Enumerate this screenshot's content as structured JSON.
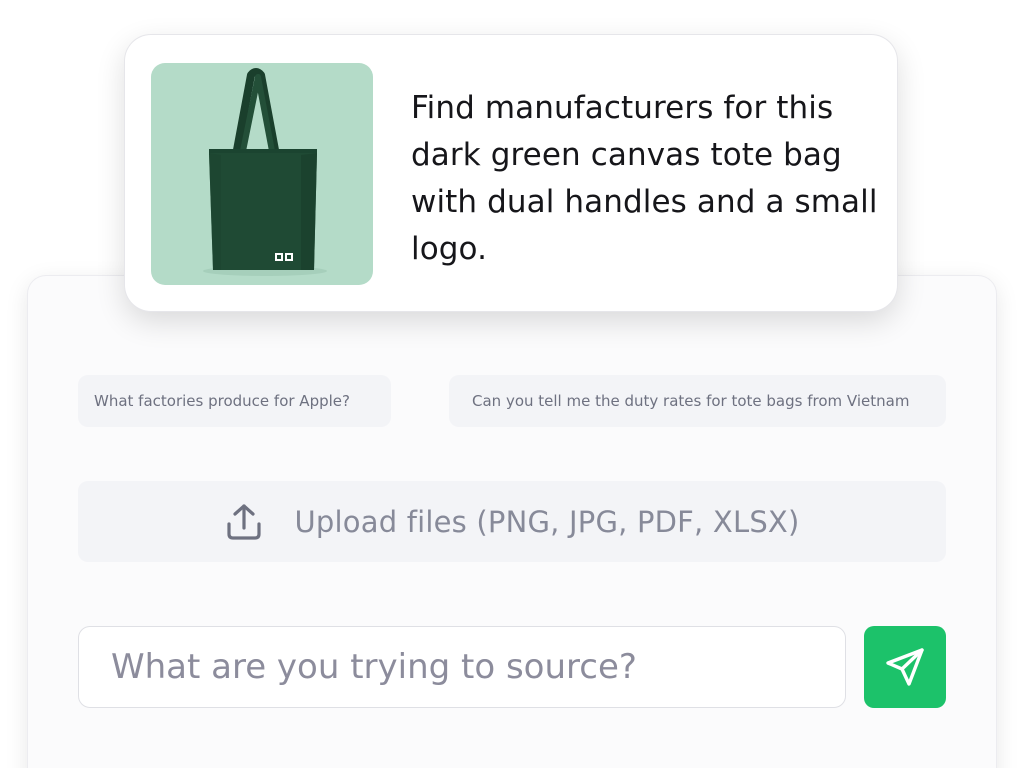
{
  "message": {
    "text": "Find manufacturers for this dark green canvas tote bag with dual handles and a small logo.",
    "image_icon": "tote-bag-image",
    "image_bg_color": "#b4dbc8",
    "bag_color": "#1f4a34"
  },
  "suggestions": [
    {
      "label": "What factories produce for Apple?"
    },
    {
      "label": "Can you tell me the duty rates for tote bags from Vietnam"
    }
  ],
  "upload": {
    "icon": "upload-icon",
    "label": "Upload files (PNG, JPG, PDF, XLSX)"
  },
  "composer": {
    "placeholder": "What are you trying to source?",
    "value": "",
    "send_icon": "send-icon",
    "send_color": "#1cc26a"
  }
}
